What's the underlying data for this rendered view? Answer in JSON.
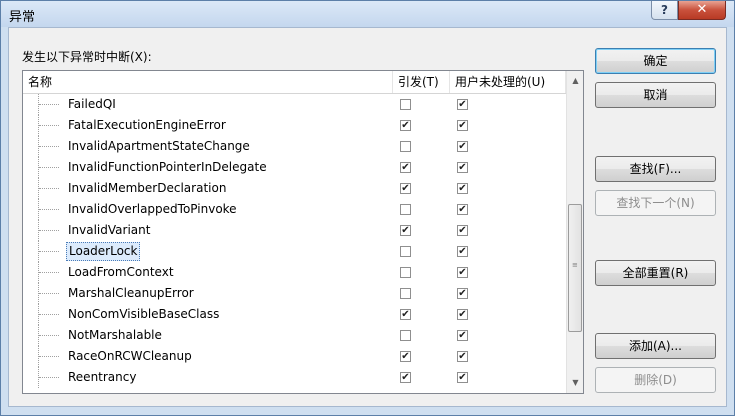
{
  "window": {
    "title": "异常",
    "help_label": "?",
    "close_label": "✕"
  },
  "prompt": "发生以下异常时中断(X):",
  "columns": {
    "name": "名称",
    "thrown": "引发(T)",
    "unhandled": "用户未处理的(U)"
  },
  "rows": [
    {
      "name": "FailedQI",
      "thrown": false,
      "unhandled": true,
      "selected": false
    },
    {
      "name": "FatalExecutionEngineError",
      "thrown": true,
      "unhandled": true,
      "selected": false
    },
    {
      "name": "InvalidApartmentStateChange",
      "thrown": false,
      "unhandled": true,
      "selected": false
    },
    {
      "name": "InvalidFunctionPointerInDelegate",
      "thrown": true,
      "unhandled": true,
      "selected": false
    },
    {
      "name": "InvalidMemberDeclaration",
      "thrown": true,
      "unhandled": true,
      "selected": false
    },
    {
      "name": "InvalidOverlappedToPinvoke",
      "thrown": false,
      "unhandled": true,
      "selected": false
    },
    {
      "name": "InvalidVariant",
      "thrown": true,
      "unhandled": true,
      "selected": false
    },
    {
      "name": "LoaderLock",
      "thrown": false,
      "unhandled": true,
      "selected": true
    },
    {
      "name": "LoadFromContext",
      "thrown": false,
      "unhandled": true,
      "selected": false
    },
    {
      "name": "MarshalCleanupError",
      "thrown": false,
      "unhandled": true,
      "selected": false
    },
    {
      "name": "NonComVisibleBaseClass",
      "thrown": true,
      "unhandled": true,
      "selected": false
    },
    {
      "name": "NotMarshalable",
      "thrown": false,
      "unhandled": true,
      "selected": false
    },
    {
      "name": "RaceOnRCWCleanup",
      "thrown": true,
      "unhandled": true,
      "selected": false
    },
    {
      "name": "Reentrancy",
      "thrown": true,
      "unhandled": true,
      "selected": false
    }
  ],
  "buttons": {
    "ok": "确定",
    "cancel": "取消",
    "find": "查找(F)...",
    "find_next": "查找下一个(N)",
    "reset_all": "全部重置(R)",
    "add": "添加(A)...",
    "delete": "删除(D)"
  }
}
